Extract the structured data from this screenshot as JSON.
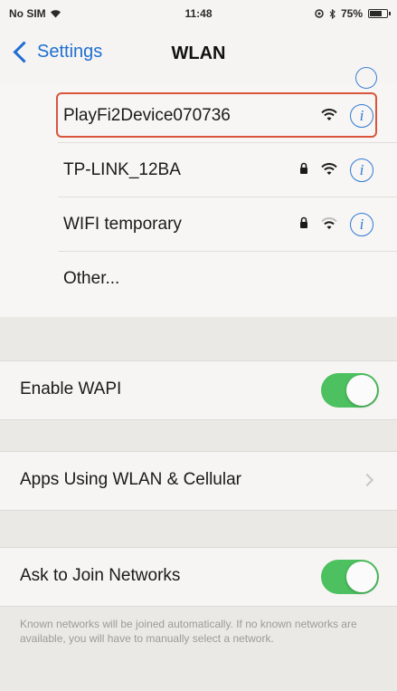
{
  "status_bar": {
    "carrier": "No SIM",
    "time": "11:48",
    "battery": "75%",
    "battery_level": 0.75
  },
  "nav": {
    "back_label": "Settings",
    "title": "WLAN"
  },
  "networks": [
    {
      "name": "PlayFi2Device070736",
      "locked": false,
      "highlighted": true
    },
    {
      "name": "TP-LINK_12BA",
      "locked": true,
      "highlighted": false
    },
    {
      "name": "WIFI temporary",
      "locked": true,
      "highlighted": false
    }
  ],
  "other_label": "Other...",
  "wapi": {
    "label": "Enable WAPI",
    "on": true
  },
  "apps_label": "Apps Using WLAN & Cellular",
  "ask_join": {
    "label": "Ask to Join Networks",
    "on": true,
    "footer": "Known networks will be joined automatically. If no known networks are available, you will have to manually select a network."
  },
  "colors": {
    "accent": "#1f6fd1",
    "toggle_on": "#4dc05f",
    "highlight": "#d9553b"
  },
  "icons": {
    "info": "info-icon",
    "wifi": "wifi-icon",
    "lock": "lock-icon",
    "back": "chevron-left-icon",
    "disclosure": "chevron-right-icon"
  }
}
